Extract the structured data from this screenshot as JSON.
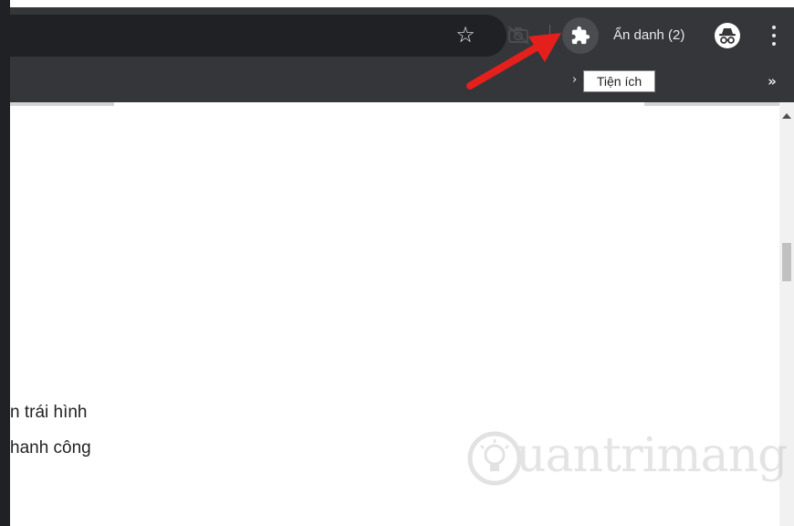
{
  "toolbar": {
    "profile_label": "Ẩn danh (2)",
    "icons": [
      "star-icon",
      "camera-off-icon",
      "puzzle-extensions-icon",
      "incognito-icon",
      "more-menu-icon"
    ]
  },
  "bookmarks": {
    "partial_chevron": "›",
    "overflow_label": "»"
  },
  "tooltip": {
    "text": "Tiện ích"
  },
  "content": {
    "line1": "n trái hình",
    "line2": "hanh công"
  },
  "watermark": {
    "text": "uantrimang"
  },
  "colors": {
    "toolbar_bg": "#35363a",
    "omnibox_bg": "#202124",
    "arrow_red": "#e5201c",
    "icon_light": "#e8eaed"
  }
}
